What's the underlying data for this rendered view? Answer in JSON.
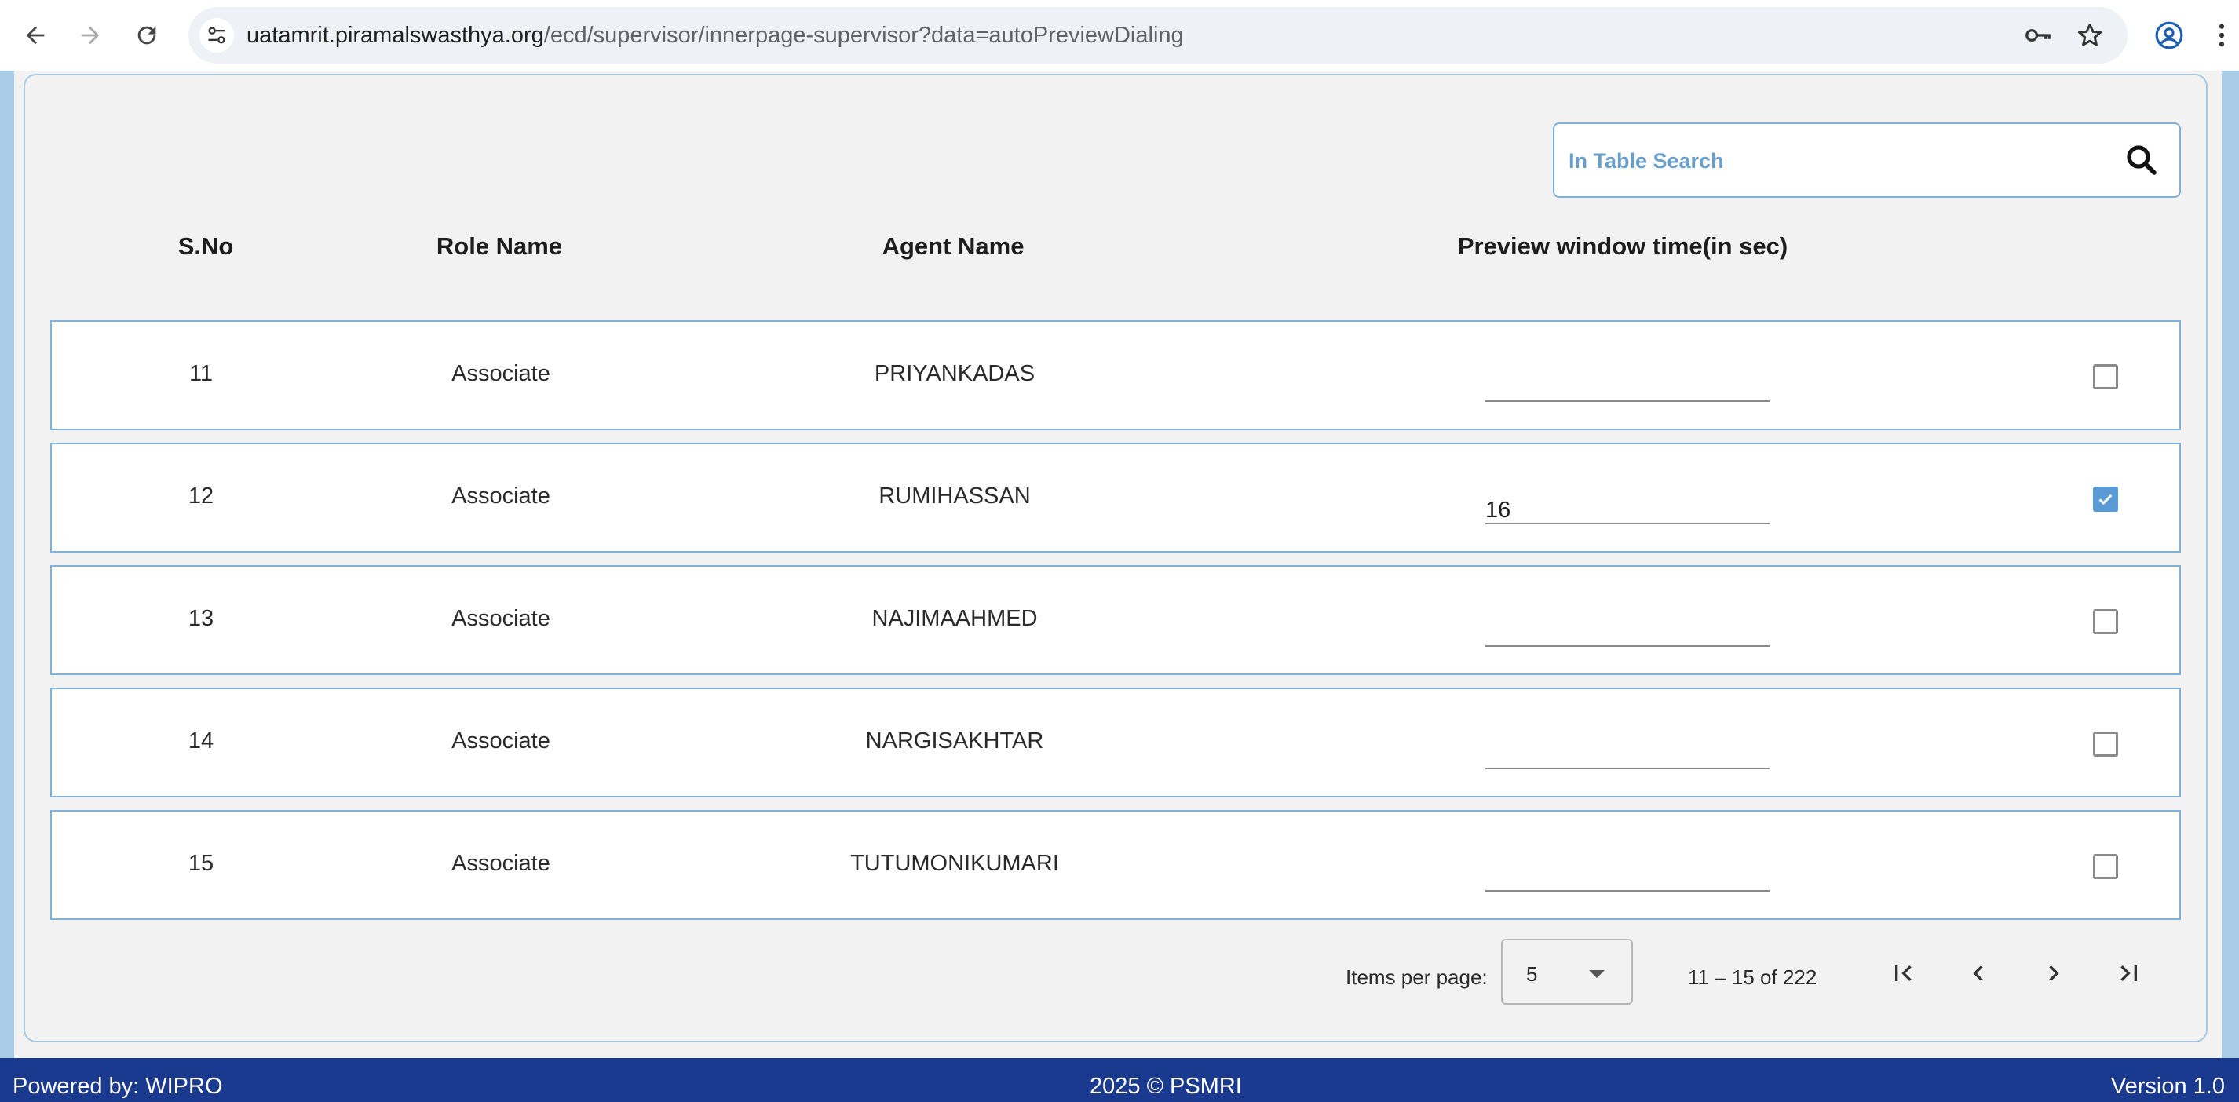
{
  "browser": {
    "url_host": "uatamrit.piramalswasthya.org",
    "url_path": "/ecd/supervisor/innerpage-supervisor?data=autoPreviewDialing"
  },
  "search": {
    "placeholder": "In Table Search"
  },
  "table": {
    "headers": [
      "S.No",
      "Role Name",
      "Agent Name",
      "Preview window time(in sec)"
    ],
    "rows": [
      {
        "sno": "11",
        "role": "Associate",
        "agent": "PRIYANKADAS",
        "time": "",
        "checked": false
      },
      {
        "sno": "12",
        "role": "Associate",
        "agent": "RUMIHASSAN",
        "time": "16",
        "checked": true
      },
      {
        "sno": "13",
        "role": "Associate",
        "agent": "NAJIMAAHMED",
        "time": "",
        "checked": false
      },
      {
        "sno": "14",
        "role": "Associate",
        "agent": "NARGISAKHTAR",
        "time": "",
        "checked": false
      },
      {
        "sno": "15",
        "role": "Associate",
        "agent": "TUTUMONIKUMARI",
        "time": "",
        "checked": false
      }
    ]
  },
  "paginator": {
    "items_per_page_label": "Items per page:",
    "page_size": "5",
    "range_label": "11 – 15 of 222"
  },
  "footer": {
    "powered_by": "Powered by: WIPRO",
    "copyright": "2025 © PSMRI",
    "version": "Version 1.0"
  },
  "colors": {
    "accent": "#5b9bd5",
    "row_border": "#7fb2d9",
    "footer_bg": "#1a3a8f",
    "side_strip": "#a9cde7"
  },
  "icons": [
    "back-arrow-icon",
    "forward-arrow-icon",
    "reload-icon",
    "site-info-icon",
    "key-icon",
    "star-icon",
    "profile-icon",
    "kebab-menu-icon",
    "search-icon",
    "checkmark-icon",
    "dropdown-caret-icon",
    "first-page-icon",
    "previous-page-icon",
    "next-page-icon",
    "last-page-icon"
  ]
}
